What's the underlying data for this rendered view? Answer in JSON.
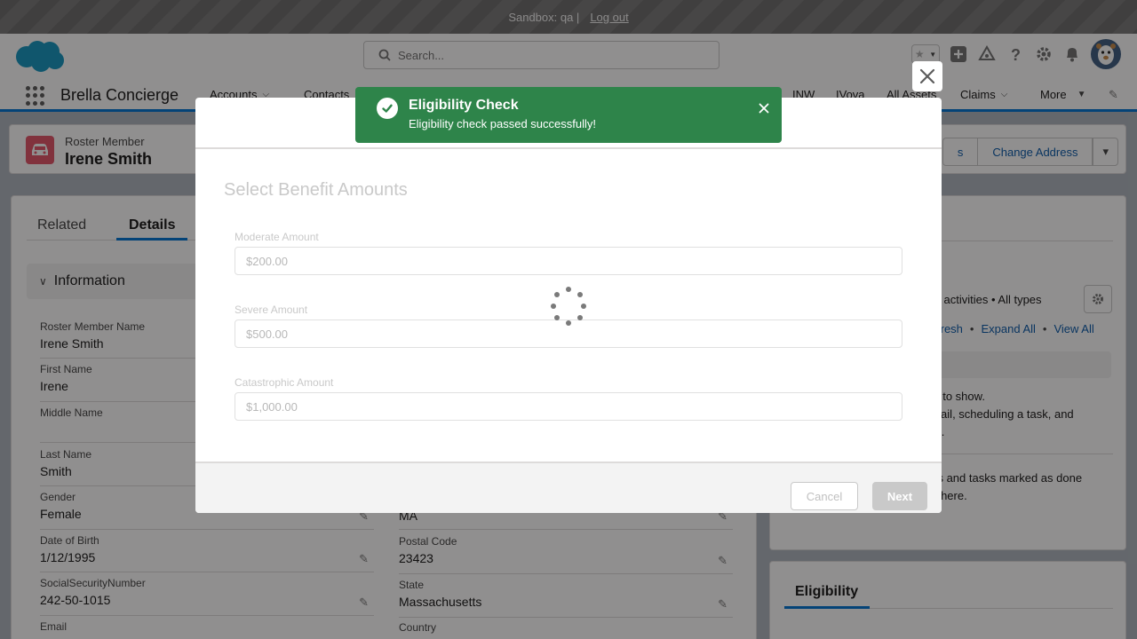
{
  "sandbox": {
    "label": "Sandbox: qa |",
    "logout": "Log out"
  },
  "header": {
    "search_placeholder": "Search...",
    "app_name": "Brella Concierge",
    "nav": [
      {
        "label": "Accounts",
        "has_menu": true
      },
      {
        "label": "Contacts"
      },
      {
        "label": "INW"
      },
      {
        "label": "IVova"
      },
      {
        "label": "All Assets"
      },
      {
        "label": "Claims",
        "has_menu": true
      },
      {
        "label": "More",
        "has_menu": true
      }
    ]
  },
  "record": {
    "type": "Roster Member",
    "name": "Irene Smith",
    "buttons": [
      "s",
      "Change Address"
    ]
  },
  "tabs": {
    "related": "Related",
    "details": "Details"
  },
  "section": {
    "title": "Information"
  },
  "fields_left": [
    {
      "label": "Roster Member Name",
      "value": "Irene Smith"
    },
    {
      "label": "First Name",
      "value": "Irene"
    },
    {
      "label": "Middle Name",
      "value": ""
    },
    {
      "label": "Last Name",
      "value": "Smith"
    },
    {
      "label": "Gender",
      "value": "Female"
    },
    {
      "label": "Date of Birth",
      "value": "1/12/1995"
    },
    {
      "label": "SocialSecurityNumber",
      "value": "242-50-1015"
    },
    {
      "label": "Email",
      "value": ""
    }
  ],
  "fields_right": [
    {
      "label": "",
      "value": "MA"
    },
    {
      "label": "Postal Code",
      "value": "23423"
    },
    {
      "label": "State",
      "value": "Massachusetts"
    },
    {
      "label": "Country",
      "value": ""
    }
  ],
  "activity": {
    "filter": "• All activities • All types",
    "links": [
      "fresh",
      "Expand All",
      "View All"
    ],
    "empty_line1": "ies to show.",
    "empty_line2": "email, scheduling a task, and",
    "empty_line3": "ore.",
    "past_line1": "ngs and tasks marked as done",
    "past_line2": "up here."
  },
  "eligibility_card": {
    "title": "Eligibility"
  },
  "modal": {
    "subtitle": "Select Benefit Amounts",
    "amounts": [
      {
        "label": "Moderate Amount",
        "value": "$200.00"
      },
      {
        "label": "Severe Amount",
        "value": "$500.00"
      },
      {
        "label": "Catastrophic Amount",
        "value": "$1,000.00"
      }
    ],
    "cancel": "Cancel",
    "next": "Next"
  },
  "toast": {
    "title": "Eligibility Check",
    "message": "Eligibility check passed successfully!",
    "color": "#2e844a"
  },
  "colors": {
    "brand": "#0176d3",
    "link": "#0b5cab",
    "record_icon": "#e3566b"
  }
}
